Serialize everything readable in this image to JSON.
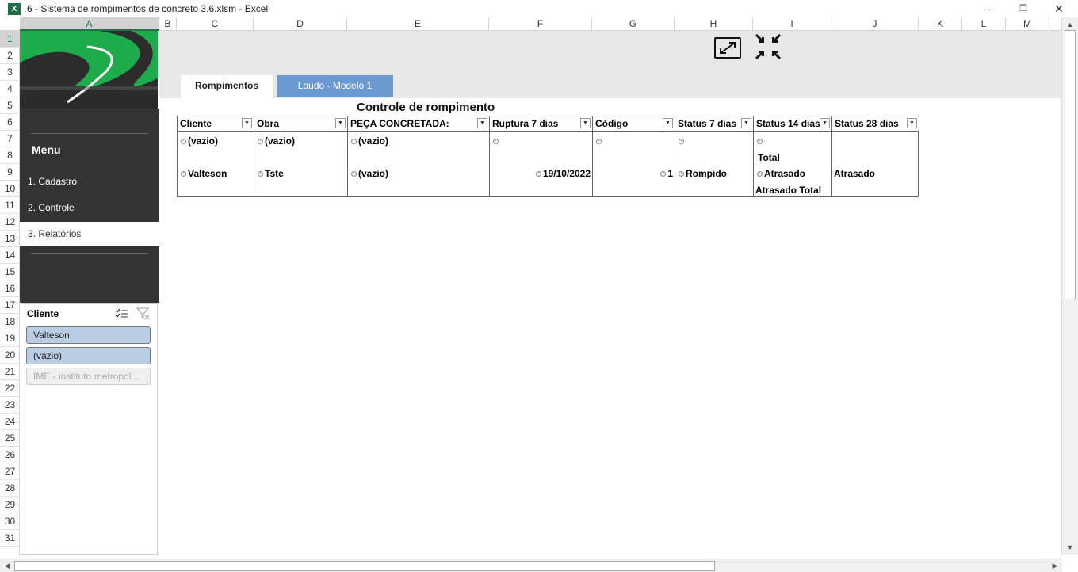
{
  "window": {
    "title": "6 - Sistema de rompimentos de concreto 3.6.xlsm - Excel",
    "app_icon": "excel-icon"
  },
  "grid": {
    "columns": [
      "A",
      "B",
      "C",
      "D",
      "E",
      "F",
      "G",
      "H",
      "I",
      "J",
      "K",
      "L",
      "M"
    ],
    "rows": [
      "1",
      "2",
      "3",
      "4",
      "5",
      "6",
      "7",
      "8",
      "9",
      "10",
      "11",
      "12",
      "13",
      "14",
      "15",
      "16",
      "17",
      "18",
      "19",
      "20",
      "21",
      "22",
      "23",
      "24",
      "25",
      "26",
      "27",
      "28",
      "29",
      "30",
      "31"
    ],
    "selected_cell": "A1"
  },
  "sidebar": {
    "menu_title": "Menu",
    "items": [
      {
        "label": "1. Cadastro"
      },
      {
        "label": "2. Controle"
      },
      {
        "label": "3. Relatórios"
      }
    ],
    "active_item": "3. Relatórios"
  },
  "tabs": [
    {
      "label": "Rompimentos"
    },
    {
      "label": "Laudo - Modelo 1"
    }
  ],
  "icons": {
    "expand": "expand-icon",
    "compress": "compress-icon"
  },
  "pivot": {
    "title": "Controle de rompimento",
    "headers": [
      "Cliente",
      "Obra",
      "PEÇA CONCRETADA:",
      "Ruptura 7 dias",
      "Código",
      "Status 7 dias",
      "Status 14 dias",
      "Status 28 dias"
    ],
    "cells": {
      "r1_cliente": "(vazio)",
      "r1_obra": "(vazio)",
      "r1_peca": "(vazio)",
      "total": "Total",
      "r2_cliente": "Valteson",
      "r2_obra": "Tste",
      "r2_peca": "(vazio)",
      "r2_ruptura": "19/10/2022",
      "r2_codigo": "1",
      "r2_status7": "Rompido",
      "r2_status14": "Atrasado",
      "r2_status28": "Atrasado",
      "atrasado_total": "Atrasado Total"
    }
  },
  "slicer": {
    "title": "Cliente",
    "items": [
      "Valteson",
      "(vazio)",
      "IME - instituto metropol..."
    ]
  },
  "colors": {
    "accent": "#217346",
    "menu_bg": "#333333",
    "tab_active": "#6b9ad1",
    "slicer_item": "#b9cde5",
    "logo_green": "#1eab4c"
  }
}
